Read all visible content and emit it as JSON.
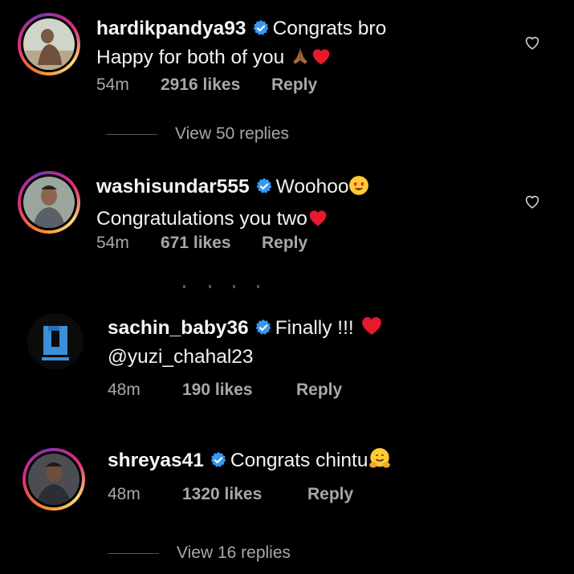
{
  "comments": [
    {
      "username": "hardikpandya93",
      "text_line1": "Congrats bro",
      "text_line2": "Happy for both of you",
      "time": "54m",
      "likes": "2916 likes",
      "reply_label": "Reply",
      "view_replies": "View 50 replies",
      "avatar_ring": "#dd2a7b"
    },
    {
      "username": "washisundar555",
      "text_line1": "Woohoo",
      "text_line2": "Congratulations you two",
      "time": "54m",
      "likes": "671 likes",
      "reply_label": "Reply",
      "avatar_ring": "#dd2a7b"
    },
    {
      "username": "sachin_baby36",
      "text_line1": "Finally !!!",
      "text_line2": "@yuzi_chahal23",
      "time": "48m",
      "likes": "190 likes",
      "reply_label": "Reply"
    },
    {
      "username": "shreyas41",
      "text_line1": "Congrats chintu",
      "time": "48m",
      "likes": "1320 likes",
      "reply_label": "Reply",
      "view_replies": "View 16 replies",
      "avatar_ring": "#dd2a7b"
    }
  ],
  "icons": {
    "verified": "verified-badge-icon",
    "like": "heart-outline-icon",
    "love": "red-heart-emoji",
    "pray": "folded-hands-emoji",
    "heart_eyes": "heart-eyes-emoji",
    "hug": "hugging-face-emoji"
  },
  "colors": {
    "background": "#000000",
    "text": "#f5f5f5",
    "muted": "#a8a8a8",
    "verified_blue": "#3897f0",
    "heart_red": "#e8192c"
  }
}
